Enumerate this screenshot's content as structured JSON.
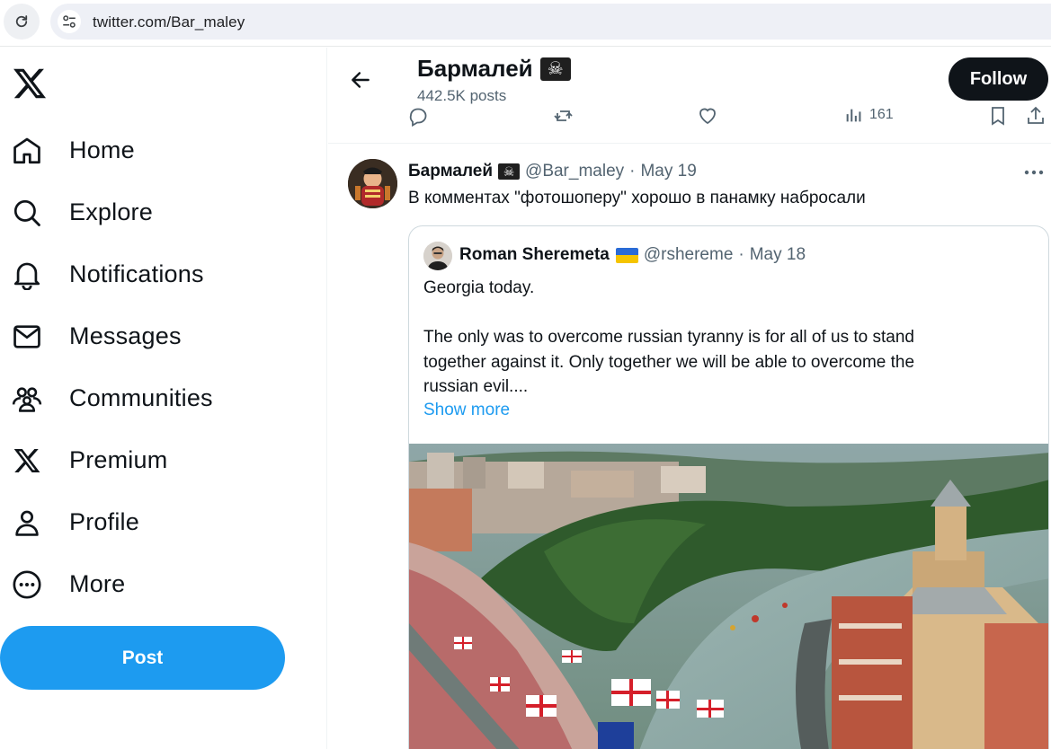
{
  "browser": {
    "url": "twitter.com/Bar_maley"
  },
  "sidebar": {
    "items": [
      {
        "label": "Home",
        "icon": "home-icon"
      },
      {
        "label": "Explore",
        "icon": "search-icon"
      },
      {
        "label": "Notifications",
        "icon": "bell-icon"
      },
      {
        "label": "Messages",
        "icon": "envelope-icon"
      },
      {
        "label": "Communities",
        "icon": "people-icon"
      },
      {
        "label": "Premium",
        "icon": "x-logo-icon"
      },
      {
        "label": "Profile",
        "icon": "person-icon"
      },
      {
        "label": "More",
        "icon": "more-circle-icon"
      }
    ],
    "post_label": "Post"
  },
  "header": {
    "title": "Бармалей",
    "title_emoji": "☠",
    "posts_count": "442.5K posts",
    "follow_label": "Follow",
    "views_partial": "161"
  },
  "tweet": {
    "name": "Бармалей",
    "name_emoji": "☠",
    "handle": "@Bar_maley",
    "separator": "·",
    "date": "May 19",
    "text": "В комментах \"фотошоперу\" хорошо в панамку набросали",
    "quote": {
      "name": "Roman Sheremeta",
      "handle": "@rshereme",
      "separator": "·",
      "date": "May 18",
      "line1": "Georgia today.",
      "line2": "The only was to overcome russian tyranny is for all of us to stand",
      "line3": "together against it. Only together we will be able to overcome the",
      "line4": "russian evil....",
      "show_more": "Show more"
    }
  },
  "colors": {
    "accent": "#1d9bf0",
    "text": "#0f1419",
    "muted": "#536471",
    "follow_bg": "#0f1419"
  }
}
